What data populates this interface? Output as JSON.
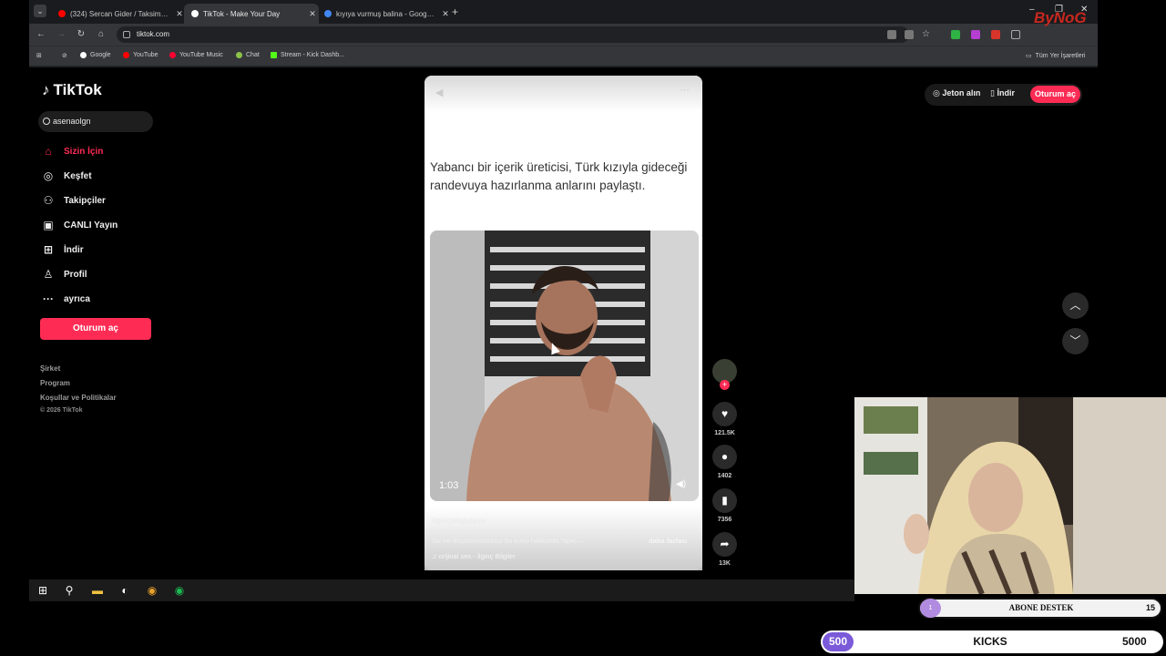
{
  "browser": {
    "tabs": [
      {
        "title": "(324) Sercan Gider / Taksim'de",
        "color": "#ff0000"
      },
      {
        "title": "TikTok - Make Your Day",
        "color": "#ffffff"
      },
      {
        "title": "kıyıya vurmuş balina - Google'd",
        "color": "#4285f4"
      }
    ],
    "url": "tiktok.com",
    "bookmarks": [
      "Google",
      "YouTube",
      "YouTube Music",
      "Chat",
      "Stream - Kick Dashb..."
    ],
    "bookmarks_folder": "Tüm Yer İşaretleri"
  },
  "tiktok": {
    "logo": "TikTok",
    "search_value": "asenaolgn",
    "nav": [
      {
        "label": "Sizin İçin",
        "icon": "home-icon"
      },
      {
        "label": "Keşfet",
        "icon": "compass-icon"
      },
      {
        "label": "Takipçiler",
        "icon": "followers-icon"
      },
      {
        "label": "CANLI Yayın",
        "icon": "live-icon"
      },
      {
        "label": "İndir",
        "icon": "download-icon"
      },
      {
        "label": "Profil",
        "icon": "profile-icon"
      },
      {
        "label": "ayrıca",
        "icon": "more-icon"
      }
    ],
    "login_label": "Oturum aç",
    "footer": [
      "Şirket",
      "Program",
      "Koşullar ve Politikalar"
    ],
    "copyright": "© 2026 TikTok",
    "top_right": {
      "coins": "Jeton alın",
      "download": "İndir",
      "login": "Oturum aç"
    },
    "video": {
      "caption": "Yabancı bir içerik üreticisi, Türk kızıyla gideceği randevuya hazırlanma anlarını paylaştı.",
      "duration": "1:03",
      "author": "ilgincbilgiolsun",
      "description": "Siz ne düşünüyorsunuz bu konu hakkında ?içirç—",
      "more": "daha fazlası",
      "sound": "orijinal ses - İlginç Bilgiler"
    },
    "actions": {
      "likes": "121.5K",
      "comments": "1402",
      "saves": "7356",
      "shares": "13K"
    }
  },
  "overlay": {
    "brand": "ByNoG",
    "goal_label": "ABONE DESTEK",
    "goal_start": "1",
    "goal_target": "15",
    "kicks_label": "KICKS",
    "kicks_current": "500",
    "kicks_target": "5000"
  },
  "colors": {
    "accent": "#fe2c55",
    "kicks": "#7a5ad8",
    "goal": "#b18be0"
  }
}
